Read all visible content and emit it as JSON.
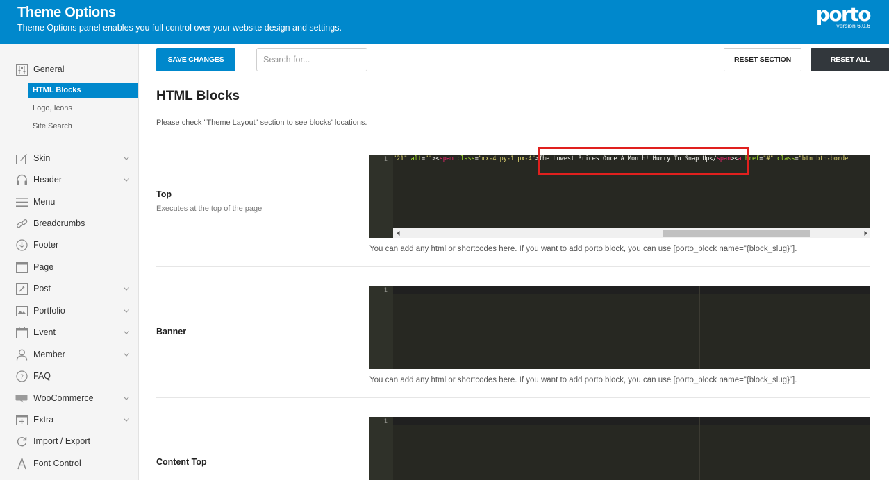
{
  "header": {
    "title": "Theme Options",
    "subtitle": "Theme Options panel enables you full control over your website design and settings.",
    "logo_text": "porto",
    "version": "version 6.0.6"
  },
  "sidebar": {
    "items": [
      {
        "label": "General",
        "icon": "sliders-icon"
      },
      {
        "label": "Skin",
        "icon": "brush-icon"
      },
      {
        "label": "Header",
        "icon": "headphones-icon"
      },
      {
        "label": "Menu",
        "icon": "menu-icon"
      },
      {
        "label": "Breadcrumbs",
        "icon": "link-icon"
      },
      {
        "label": "Footer",
        "icon": "download-icon"
      },
      {
        "label": "Page",
        "icon": "page-icon"
      },
      {
        "label": "Post",
        "icon": "post-icon"
      },
      {
        "label": "Portfolio",
        "icon": "image-icon"
      },
      {
        "label": "Event",
        "icon": "calendar-icon"
      },
      {
        "label": "Member",
        "icon": "user-icon"
      },
      {
        "label": "FAQ",
        "icon": "help-icon"
      },
      {
        "label": "WooCommerce",
        "icon": "woo-icon"
      },
      {
        "label": "Extra",
        "icon": "plus-box-icon"
      },
      {
        "label": "Import / Export",
        "icon": "refresh-icon"
      },
      {
        "label": "Font Control",
        "icon": "font-icon"
      }
    ],
    "general_subitems": [
      {
        "label": "HTML Blocks",
        "active": true
      },
      {
        "label": "Logo, Icons",
        "active": false
      },
      {
        "label": "Site Search",
        "active": false
      }
    ]
  },
  "toolbar": {
    "save_label": "SAVE CHANGES",
    "search_placeholder": "Search for...",
    "reset_section_label": "RESET SECTION",
    "reset_all_label": "RESET ALL"
  },
  "main": {
    "title": "HTML Blocks",
    "description": "Please check \"Theme Layout\" section to see blocks' locations.",
    "help_text": "You can add any html or shortcodes here. If you want to add porto block, you can use [porto_block name=\"{block_slug}\"].",
    "fields": [
      {
        "label": "Top",
        "sublabel": "Executes at the top of the page",
        "line_number": "1",
        "code_tokens": [
          {
            "t": "str",
            "v": "\"21\" "
          },
          {
            "t": "attr",
            "v": "alt"
          },
          {
            "t": "txt",
            "v": "="
          },
          {
            "t": "str",
            "v": "\"\""
          },
          {
            "t": "txt",
            "v": "><"
          },
          {
            "t": "tag",
            "v": "span"
          },
          {
            "t": "txt",
            "v": " "
          },
          {
            "t": "attr",
            "v": "class"
          },
          {
            "t": "txt",
            "v": "="
          },
          {
            "t": "str",
            "v": "\"mx-4 py-1 px-4\""
          },
          {
            "t": "txt",
            "v": ">The Lowest Prices Once A Month! Hurry To Snap Up</"
          },
          {
            "t": "tag",
            "v": "span"
          },
          {
            "t": "txt",
            "v": "><"
          },
          {
            "t": "tag",
            "v": "a"
          },
          {
            "t": "txt",
            "v": " "
          },
          {
            "t": "attr",
            "v": "href"
          },
          {
            "t": "txt",
            "v": "="
          },
          {
            "t": "str",
            "v": "\"#\""
          },
          {
            "t": "txt",
            "v": " "
          },
          {
            "t": "attr",
            "v": "class"
          },
          {
            "t": "txt",
            "v": "="
          },
          {
            "t": "str",
            "v": "\"btn btn-borde"
          }
        ]
      },
      {
        "label": "Banner",
        "sublabel": "",
        "line_number": "1"
      },
      {
        "label": "Content Top",
        "sublabel": "",
        "line_number": "1"
      }
    ]
  },
  "colors": {
    "brand": "#0088cc",
    "dark_button": "#32373c",
    "editor_bg": "#272822",
    "highlight": "#e0201e"
  }
}
